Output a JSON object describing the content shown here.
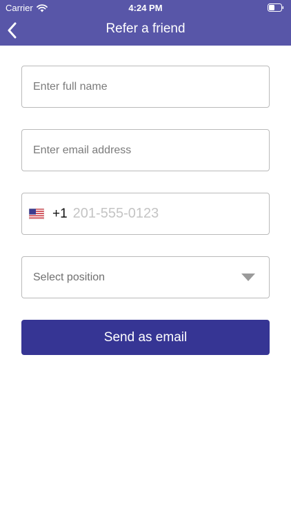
{
  "status_bar": {
    "carrier": "Carrier",
    "time": "4:24 PM"
  },
  "nav": {
    "title": "Refer a friend"
  },
  "form": {
    "full_name_placeholder": "Enter full name",
    "email_placeholder": "Enter email address",
    "phone_country": "United States",
    "phone_dial_code": "+1",
    "phone_placeholder": "201-555-0123",
    "position_placeholder": "Select position",
    "submit_label": "Send as email"
  },
  "colors": {
    "header_bg": "#5856a8",
    "button_bg": "#363594",
    "field_border": "#b9b9b9"
  }
}
